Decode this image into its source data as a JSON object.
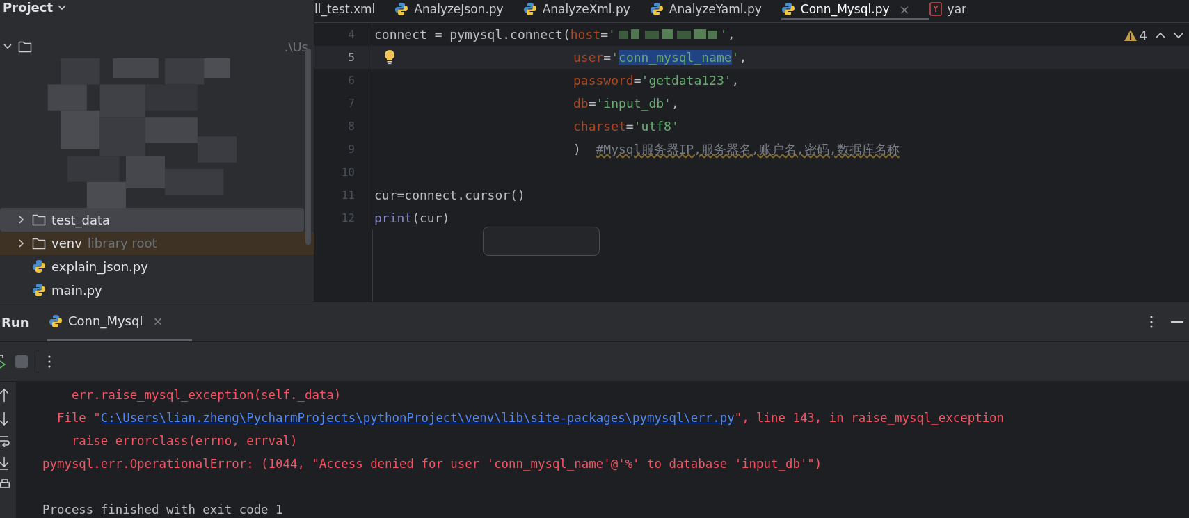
{
  "project_panel": {
    "title": "Project",
    "tree": [
      {
        "kind": "root",
        "path_hint": ".\\Us",
        "expanded": true,
        "selected": false,
        "excluded": false,
        "children": [
          {
            "kind": "folder",
            "label": "test_data",
            "expanded": false,
            "selected": true,
            "excluded": false
          },
          {
            "kind": "folder",
            "label": "venv",
            "note": "library root",
            "expanded": false,
            "selected": false,
            "excluded": true
          },
          {
            "kind": "python",
            "label": "explain_json.py",
            "selected": false,
            "excluded": false
          },
          {
            "kind": "python",
            "label": "main.py",
            "selected": false,
            "excluded": false
          }
        ]
      }
    ]
  },
  "editor_tabs": [
    {
      "kind": "xml",
      "label": "ll_test.xml",
      "selected": false
    },
    {
      "kind": "python",
      "label": "AnalyzeJson.py",
      "selected": false
    },
    {
      "kind": "python",
      "label": "AnalyzeXml.py",
      "selected": false
    },
    {
      "kind": "python",
      "label": "AnalyzeYaml.py",
      "selected": false
    },
    {
      "kind": "python",
      "label": "Conn_Mysql.py",
      "selected": true,
      "close": "×"
    },
    {
      "kind": "yaml",
      "label": "yar",
      "selected": false
    }
  ],
  "editor": {
    "warnings": "4",
    "lines": [
      {
        "number": "4",
        "current": false,
        "continuation": false,
        "bulb": false,
        "tokens": [
          {
            "kind": "plain",
            "text": "connect = pymysql.connect("
          },
          {
            "kind": "param",
            "text": "host"
          },
          {
            "kind": "plain",
            "text": "="
          },
          {
            "kind": "string",
            "text": "'"
          },
          {
            "kind": "redacted"
          },
          {
            "kind": "string",
            "text": "'"
          },
          {
            "kind": "plain",
            "text": ","
          }
        ]
      },
      {
        "number": "5",
        "current": true,
        "continuation": true,
        "bulb": true,
        "tokens": [
          {
            "kind": "param",
            "text": "user"
          },
          {
            "kind": "plain",
            "text": "="
          },
          {
            "kind": "string",
            "text": "'"
          },
          {
            "kind": "selected",
            "text": "conn_mysql_name"
          },
          {
            "kind": "string",
            "text": "'"
          },
          {
            "kind": "plain",
            "text": ","
          }
        ]
      },
      {
        "number": "6",
        "current": false,
        "continuation": true,
        "bulb": false,
        "tokens": [
          {
            "kind": "param",
            "text": "password"
          },
          {
            "kind": "plain",
            "text": "="
          },
          {
            "kind": "string",
            "text": "'getdata123'"
          },
          {
            "kind": "plain",
            "text": ","
          }
        ]
      },
      {
        "number": "7",
        "current": false,
        "continuation": true,
        "bulb": false,
        "tokens": [
          {
            "kind": "param",
            "text": "db"
          },
          {
            "kind": "plain",
            "text": "="
          },
          {
            "kind": "string",
            "text": "'input_db'"
          },
          {
            "kind": "plain",
            "text": ","
          }
        ]
      },
      {
        "number": "8",
        "current": false,
        "continuation": true,
        "bulb": false,
        "tokens": [
          {
            "kind": "param",
            "text": "charset"
          },
          {
            "kind": "plain",
            "text": "="
          },
          {
            "kind": "string",
            "text": "'utf8'"
          }
        ]
      },
      {
        "number": "9",
        "current": false,
        "continuation": true,
        "bulb": false,
        "tokens": [
          {
            "kind": "plain",
            "text": ")  "
          },
          {
            "kind": "comment",
            "text": "#Mysql服务器IP,服务器名,账户名,密码,数据库名称"
          }
        ]
      },
      {
        "number": "10",
        "current": false,
        "bulb": false
      },
      {
        "number": "11",
        "current": false,
        "continuation": false,
        "bulb": false,
        "tokens": [
          {
            "kind": "plain",
            "text": "cur=connect.cursor()"
          }
        ]
      },
      {
        "number": "12",
        "current": false,
        "continuation": false,
        "bulb": false,
        "tokens": [
          {
            "kind": "builtin",
            "text": "print"
          },
          {
            "kind": "plain",
            "text": "(cur)"
          }
        ]
      }
    ]
  },
  "run_panel": {
    "title": "Run",
    "tabs": [
      {
        "label": "Conn_Mysql",
        "selected": true,
        "close": "×"
      }
    ],
    "console": [
      {
        "kind": "trace",
        "segments": [
          {
            "kind": "error",
            "text": "    err.raise_mysql_exception(self._data)"
          }
        ]
      },
      {
        "kind": "trace",
        "segments": [
          {
            "kind": "error",
            "text": "  File \""
          },
          {
            "kind": "link",
            "text": "C:\\Users\\lian.zheng\\PycharmProjects\\pythonProject\\venv\\lib\\site-packages\\pymysql\\err.py"
          },
          {
            "kind": "error",
            "text": "\", line 143, in raise_mysql_exception"
          }
        ]
      },
      {
        "kind": "trace",
        "segments": [
          {
            "kind": "error",
            "text": "    raise errorclass(errno, errval)"
          }
        ]
      },
      {
        "kind": "trace",
        "segments": [
          {
            "kind": "error",
            "text": "pymysql.err.OperationalError: (1044, \"Access denied for user 'conn_mysql_name'@'%' to database 'input_db'\")"
          }
        ]
      },
      {
        "kind": "status",
        "segments": [
          {
            "kind": "normal",
            "text": "Process finished with exit code 1"
          }
        ]
      }
    ]
  }
}
